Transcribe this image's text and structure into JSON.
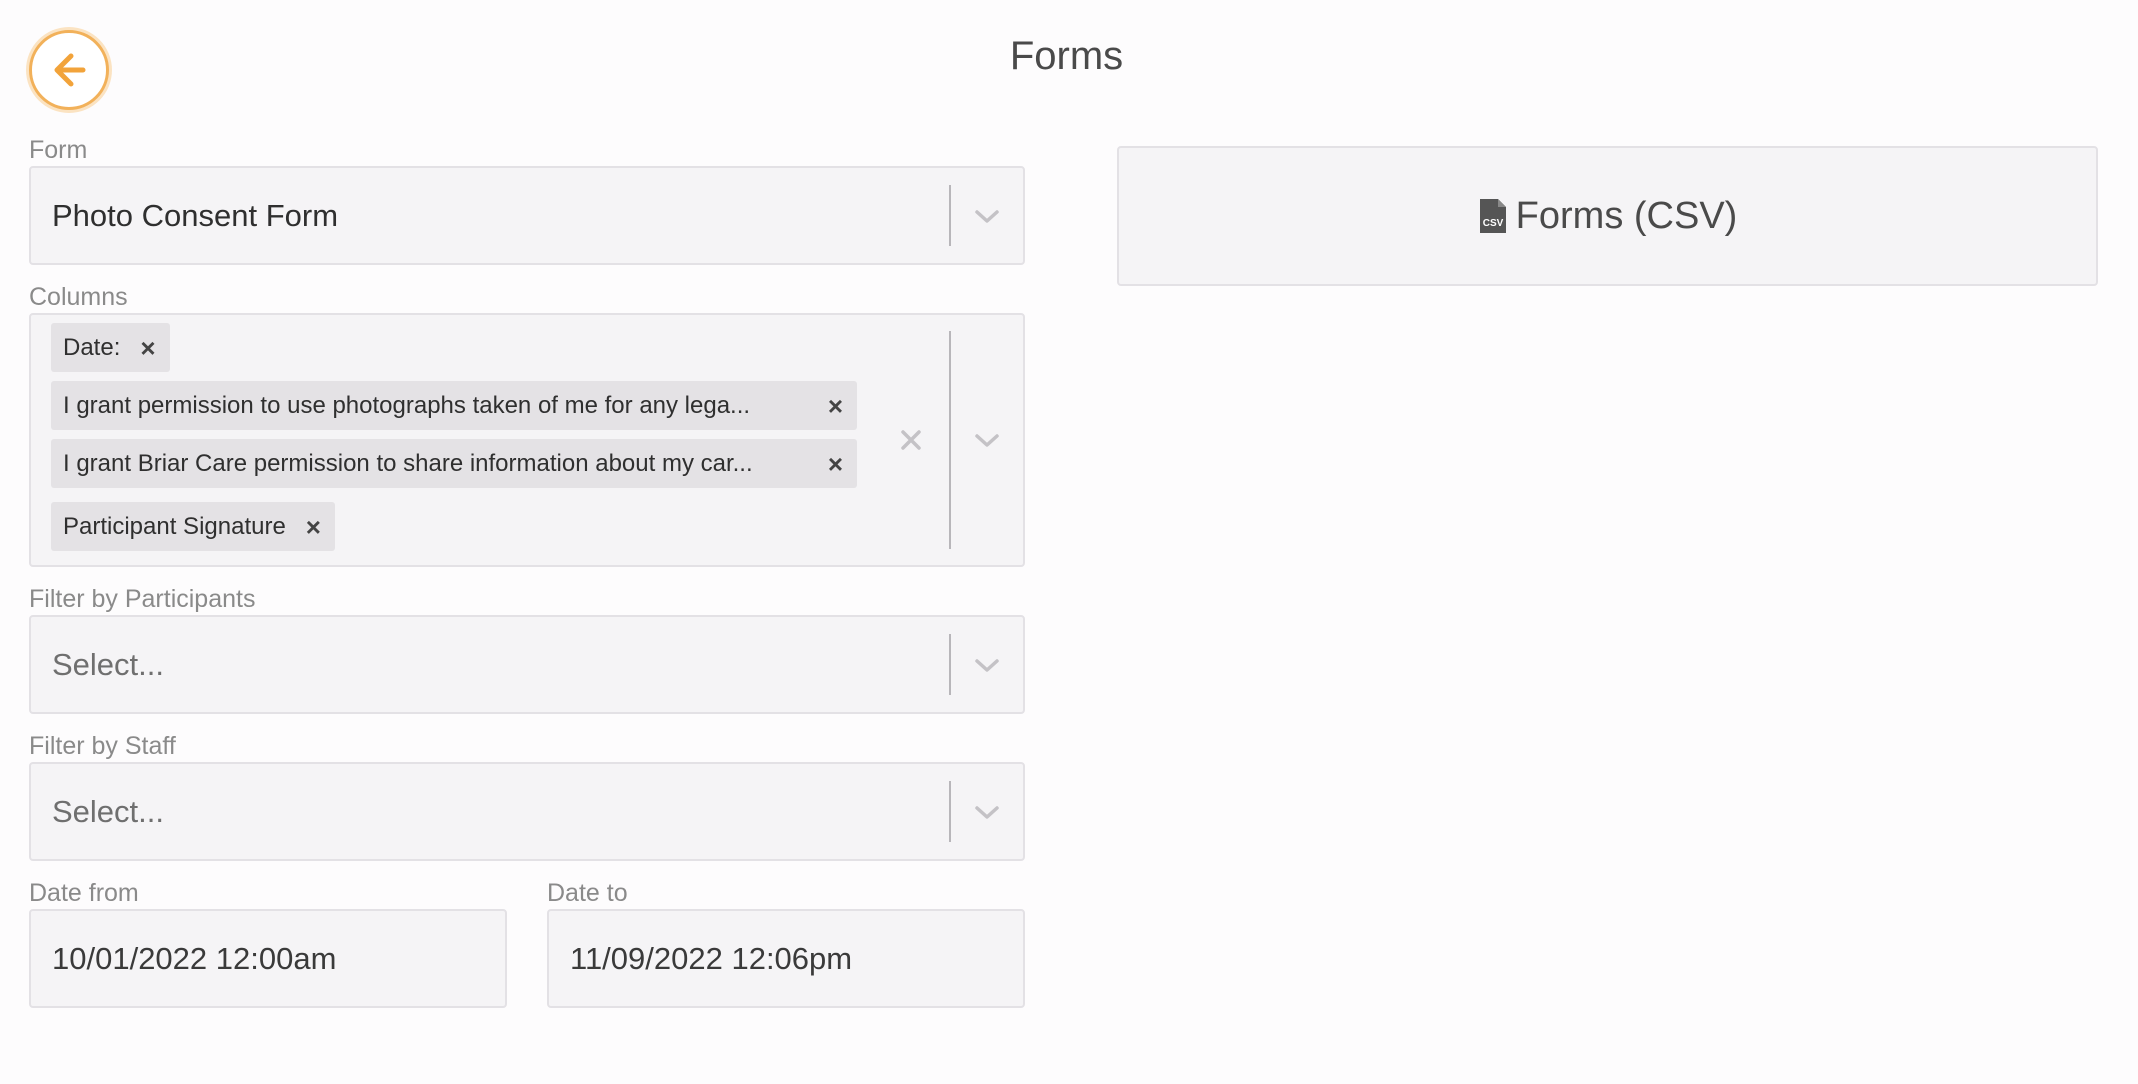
{
  "header": {
    "title": "Forms",
    "back_icon": "arrow-left-icon"
  },
  "form_field": {
    "label": "Form",
    "value": "Photo Consent Form"
  },
  "columns_field": {
    "label": "Columns",
    "chips": [
      "Date:",
      "I grant permission to use photographs taken of me for any legal purpose",
      "I grant Briar Care permission to share information about my care",
      "Participant Signature"
    ],
    "chips_displayed": [
      "Date:",
      "I grant permission to use photographs taken of me for any lega...",
      "I grant Briar Care permission to share information about my car...",
      "Participant Signature"
    ]
  },
  "participants_field": {
    "label": "Filter by Participants",
    "placeholder": "Select..."
  },
  "staff_field": {
    "label": "Filter by Staff",
    "placeholder": "Select..."
  },
  "date_from": {
    "label": "Date from",
    "value": "10/01/2022 12:00am"
  },
  "date_to": {
    "label": "Date to",
    "value": "11/09/2022 12:06pm"
  },
  "export": {
    "label": "Forms (CSV)",
    "icon": "csv-file-icon"
  },
  "colors": {
    "accent": "#f2a33a",
    "field_bg": "#f5f4f6",
    "chip_bg": "#e4e2e5"
  }
}
